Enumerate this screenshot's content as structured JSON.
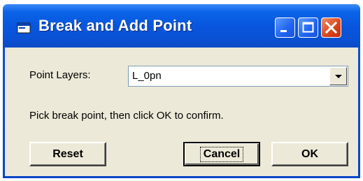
{
  "window": {
    "title": "Break and Add Point"
  },
  "form": {
    "point_layers_label": "Point Layers:",
    "point_layers_value": "L_0pn",
    "instruction": "Pick break point, then click OK to confirm."
  },
  "buttons": {
    "reset": "Reset",
    "cancel": "Cancel",
    "ok": "OK"
  },
  "icons": {
    "window": "app-window-icon",
    "minimize": "minimize-icon",
    "maximize": "maximize-icon",
    "close": "close-icon",
    "dropdown": "chevron-down-icon"
  },
  "colors": {
    "titlebar": "#0a5fe0",
    "client": "#ECE9D8",
    "close": "#d8431b"
  }
}
